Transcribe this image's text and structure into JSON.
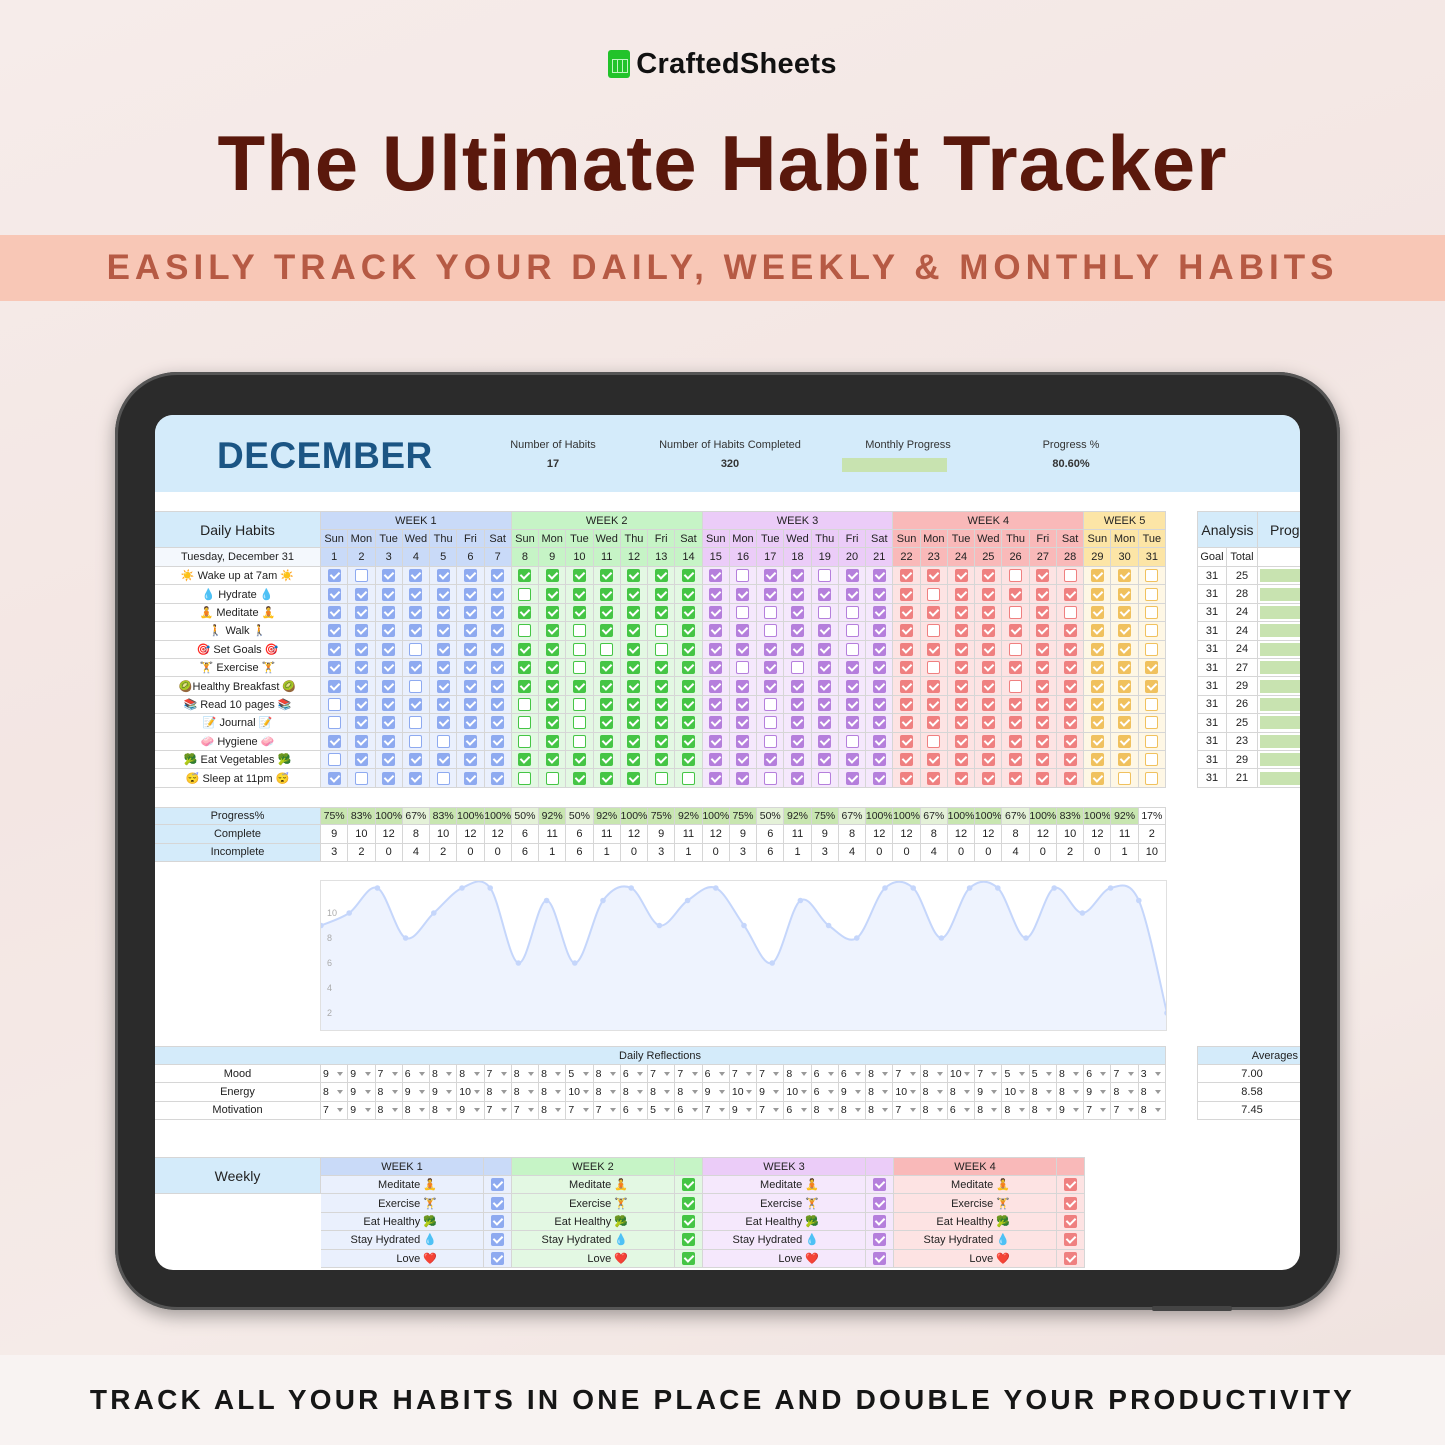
{
  "brand": {
    "name": "CraftedSheets",
    "logo_icon": "spreadsheet-logo-icon",
    "logo_color": "#22c32a"
  },
  "title": "The Ultimate Habit Tracker",
  "banner": "EASILY TRACK YOUR DAILY, WEEKLY & MONTHLY HABITS",
  "footer": "TRACK ALL YOUR HABITS IN ONE PLACE AND DOUBLE YOUR PRODUCTIVITY",
  "sheet": {
    "month": "DECEMBER",
    "stats": [
      {
        "label": "Number of Habits",
        "value": "17"
      },
      {
        "label": "Number of Habits Completed",
        "value": "320"
      },
      {
        "label": "Monthly Progress",
        "value": null,
        "progress_fraction": 0.806
      },
      {
        "label": "Progress %",
        "value": "80.60%"
      }
    ]
  },
  "colors": {
    "header_bg": "#d4ebfa",
    "progress_green": "#c8e3b0"
  },
  "daily": {
    "label": "Daily Habits",
    "current_date": "Tuesday, December 31",
    "weeks": [
      {
        "label": "WEEK 1",
        "days": 7,
        "header": "#c9daf8",
        "cell": "#eaf0fd",
        "check": "#8eaaf0"
      },
      {
        "label": "WEEK 2",
        "days": 7,
        "header": "#c6f4c6",
        "cell": "#e3f8e3",
        "check": "#45c545"
      },
      {
        "label": "WEEK 3",
        "days": 7,
        "header": "#ebccf8",
        "cell": "#f5e8fc",
        "check": "#b57fdc"
      },
      {
        "label": "WEEK 4",
        "days": 7,
        "header": "#f9b9b9",
        "cell": "#fde3e3",
        "check": "#ef8080"
      },
      {
        "label": "WEEK 5",
        "days": 3,
        "header": "#fce5a6",
        "cell": "#fef7e5",
        "check": "#f0c15e"
      }
    ],
    "day_names": [
      "Sun",
      "Mon",
      "Tue",
      "Wed",
      "Thu",
      "Fri",
      "Sat",
      "Sun",
      "Mon",
      "Tue",
      "Wed",
      "Thu",
      "Fri",
      "Sat",
      "Sun",
      "Mon",
      "Tue",
      "Wed",
      "Thu",
      "Fri",
      "Sat",
      "Sun",
      "Mon",
      "Tue",
      "Wed",
      "Thu",
      "Fri",
      "Sat",
      "Sun",
      "Mon",
      "Tue"
    ],
    "dates": [
      "1",
      "2",
      "3",
      "4",
      "5",
      "6",
      "7",
      "8",
      "9",
      "10",
      "11",
      "12",
      "13",
      "14",
      "15",
      "16",
      "17",
      "18",
      "19",
      "20",
      "21",
      "22",
      "23",
      "24",
      "25",
      "26",
      "27",
      "28",
      "29",
      "30",
      "31"
    ],
    "habits": [
      {
        "name": "☀️ Wake up at 7am ☀️",
        "goal": "31",
        "total": "25",
        "checks": [
          1,
          0,
          1,
          1,
          1,
          1,
          1,
          1,
          1,
          1,
          1,
          1,
          1,
          1,
          1,
          0,
          1,
          1,
          0,
          1,
          1,
          1,
          1,
          1,
          1,
          0,
          1,
          0,
          1,
          1,
          0
        ]
      },
      {
        "name": "💧 Hydrate 💧",
        "goal": "31",
        "total": "28",
        "checks": [
          1,
          1,
          1,
          1,
          1,
          1,
          1,
          0,
          1,
          1,
          1,
          1,
          1,
          1,
          1,
          1,
          1,
          1,
          1,
          1,
          1,
          1,
          0,
          1,
          1,
          1,
          1,
          1,
          1,
          1,
          0
        ]
      },
      {
        "name": "🧘 Meditate 🧘",
        "goal": "31",
        "total": "24",
        "checks": [
          1,
          1,
          1,
          1,
          1,
          1,
          1,
          1,
          1,
          1,
          1,
          1,
          1,
          1,
          1,
          0,
          0,
          1,
          0,
          0,
          1,
          1,
          1,
          1,
          1,
          0,
          1,
          0,
          1,
          1,
          0
        ]
      },
      {
        "name": "🚶 Walk 🚶",
        "goal": "31",
        "total": "24",
        "checks": [
          1,
          1,
          1,
          1,
          1,
          1,
          1,
          0,
          1,
          0,
          1,
          1,
          0,
          1,
          1,
          1,
          0,
          1,
          1,
          0,
          1,
          1,
          0,
          1,
          1,
          1,
          1,
          1,
          1,
          1,
          0
        ]
      },
      {
        "name": "🎯 Set Goals 🎯",
        "goal": "31",
        "total": "24",
        "checks": [
          1,
          1,
          1,
          0,
          1,
          1,
          1,
          1,
          1,
          0,
          0,
          1,
          0,
          1,
          1,
          1,
          1,
          1,
          1,
          0,
          1,
          1,
          1,
          1,
          1,
          0,
          1,
          1,
          1,
          1,
          0
        ]
      },
      {
        "name": "🏋️ Exercise 🏋️",
        "goal": "31",
        "total": "27",
        "checks": [
          1,
          1,
          1,
          1,
          1,
          1,
          1,
          1,
          1,
          0,
          1,
          1,
          1,
          1,
          1,
          0,
          1,
          0,
          1,
          1,
          1,
          1,
          0,
          1,
          1,
          1,
          1,
          1,
          1,
          1,
          1
        ]
      },
      {
        "name": "🥝Healthy Breakfast 🥝",
        "goal": "31",
        "total": "29",
        "checks": [
          1,
          1,
          1,
          0,
          1,
          1,
          1,
          1,
          1,
          1,
          1,
          1,
          1,
          1,
          1,
          1,
          1,
          1,
          1,
          1,
          1,
          1,
          1,
          1,
          1,
          0,
          1,
          1,
          1,
          1,
          1
        ]
      },
      {
        "name": "📚 Read 10 pages 📚",
        "goal": "31",
        "total": "26",
        "checks": [
          0,
          1,
          1,
          1,
          1,
          1,
          1,
          0,
          1,
          0,
          1,
          1,
          1,
          1,
          1,
          1,
          0,
          1,
          1,
          1,
          1,
          1,
          1,
          1,
          1,
          1,
          1,
          1,
          1,
          1,
          0
        ]
      },
      {
        "name": "📝 Journal 📝",
        "goal": "31",
        "total": "25",
        "checks": [
          0,
          1,
          1,
          0,
          1,
          1,
          1,
          0,
          1,
          0,
          1,
          1,
          1,
          1,
          1,
          1,
          0,
          1,
          1,
          1,
          1,
          1,
          1,
          1,
          1,
          1,
          1,
          1,
          1,
          1,
          0
        ]
      },
      {
        "name": "🧼 Hygiene 🧼",
        "goal": "31",
        "total": "23",
        "checks": [
          1,
          1,
          1,
          0,
          0,
          1,
          1,
          0,
          1,
          0,
          1,
          1,
          1,
          1,
          1,
          1,
          0,
          1,
          1,
          0,
          1,
          1,
          0,
          1,
          1,
          1,
          1,
          1,
          1,
          1,
          0
        ]
      },
      {
        "name": "🥦 Eat Vegetables 🥦",
        "goal": "31",
        "total": "29",
        "checks": [
          0,
          1,
          1,
          1,
          1,
          1,
          1,
          1,
          1,
          1,
          1,
          1,
          1,
          1,
          1,
          1,
          1,
          1,
          1,
          1,
          1,
          1,
          1,
          1,
          1,
          1,
          1,
          1,
          1,
          1,
          0
        ]
      },
      {
        "name": "😴 Sleep at 11pm 😴",
        "goal": "31",
        "total": "21",
        "checks": [
          1,
          0,
          1,
          1,
          0,
          1,
          1,
          0,
          0,
          1,
          1,
          1,
          0,
          0,
          1,
          1,
          0,
          1,
          0,
          1,
          1,
          1,
          1,
          1,
          1,
          1,
          1,
          1,
          1,
          0,
          0
        ]
      }
    ]
  },
  "analysis": {
    "label": "Analysis",
    "progress_label": "Prog",
    "goal_label": "Goal",
    "total_label": "Total"
  },
  "summary": [
    {
      "label": "Progress%",
      "values": [
        "75%",
        "83%",
        "100%",
        "67%",
        "83%",
        "100%",
        "100%",
        "50%",
        "92%",
        "50%",
        "92%",
        "100%",
        "75%",
        "92%",
        "100%",
        "75%",
        "50%",
        "92%",
        "75%",
        "67%",
        "100%",
        "100%",
        "67%",
        "100%",
        "100%",
        "67%",
        "100%",
        "83%",
        "100%",
        "92%",
        "17%"
      ]
    },
    {
      "label": "Complete",
      "values": [
        "9",
        "10",
        "12",
        "8",
        "10",
        "12",
        "12",
        "6",
        "11",
        "6",
        "11",
        "12",
        "9",
        "11",
        "12",
        "9",
        "6",
        "11",
        "9",
        "8",
        "12",
        "12",
        "8",
        "12",
        "12",
        "8",
        "12",
        "10",
        "12",
        "11",
        "2"
      ]
    },
    {
      "label": "Incomplete",
      "values": [
        "3",
        "2",
        "0",
        "4",
        "2",
        "0",
        "0",
        "6",
        "1",
        "6",
        "1",
        "0",
        "3",
        "1",
        "0",
        "3",
        "6",
        "1",
        "3",
        "4",
        "0",
        "0",
        "4",
        "0",
        "0",
        "4",
        "0",
        "2",
        "0",
        "1",
        "10"
      ]
    }
  ],
  "chart_data": {
    "type": "area",
    "x": [
      1,
      2,
      3,
      4,
      5,
      6,
      7,
      8,
      9,
      10,
      11,
      12,
      13,
      14,
      15,
      16,
      17,
      18,
      19,
      20,
      21,
      22,
      23,
      24,
      25,
      26,
      27,
      28,
      29,
      30,
      31
    ],
    "values": [
      9,
      10,
      12,
      8,
      10,
      12,
      12,
      6,
      11,
      6,
      11,
      12,
      9,
      11,
      12,
      9,
      6,
      11,
      9,
      8,
      12,
      12,
      8,
      12,
      12,
      8,
      12,
      10,
      12,
      11,
      2
    ],
    "yticks": [
      "2",
      "4",
      "6",
      "8",
      "10"
    ],
    "ylim": [
      0,
      12
    ],
    "grid": false,
    "line_color": "#c5d6fb",
    "fill_color": "#eef3fe"
  },
  "reflections": {
    "title": "Daily Reflections",
    "rows": [
      {
        "label": "Mood",
        "values": [
          "9",
          "9",
          "7",
          "6",
          "8",
          "8",
          "7",
          "8",
          "8",
          "5",
          "8",
          "6",
          "7",
          "7",
          "6",
          "7",
          "7",
          "8",
          "6",
          "6",
          "8",
          "7",
          "8",
          "10",
          "7",
          "5",
          "5",
          "8",
          "6",
          "7",
          "3"
        ]
      },
      {
        "label": "Energy",
        "values": [
          "8",
          "9",
          "8",
          "9",
          "9",
          "10",
          "8",
          "8",
          "8",
          "10",
          "8",
          "8",
          "8",
          "8",
          "9",
          "10",
          "9",
          "10",
          "6",
          "9",
          "8",
          "10",
          "8",
          "8",
          "9",
          "10",
          "8",
          "8",
          "9",
          "8",
          "8"
        ]
      },
      {
        "label": "Motivation",
        "values": [
          "7",
          "9",
          "8",
          "8",
          "8",
          "9",
          "7",
          "7",
          "8",
          "7",
          "7",
          "6",
          "5",
          "6",
          "7",
          "9",
          "7",
          "6",
          "8",
          "8",
          "8",
          "7",
          "8",
          "6",
          "8",
          "8",
          "8",
          "9",
          "7",
          "7",
          "8"
        ]
      }
    ],
    "averages_label": "Averages",
    "averages": [
      "7.00",
      "8.58",
      "7.45"
    ]
  },
  "weekly": {
    "label": "Weekly",
    "weeks": [
      {
        "label": "WEEK 1",
        "items": [
          {
            "name": "Meditate 🧘",
            "checked": true
          },
          {
            "name": "Exercise 🏋️",
            "checked": true
          },
          {
            "name": "Eat Healthy 🥦",
            "checked": true
          },
          {
            "name": "Stay Hydrated 💧",
            "checked": true
          },
          {
            "name": "Love ❤️",
            "checked": true
          }
        ]
      },
      {
        "label": "WEEK 2",
        "items": [
          {
            "name": "Meditate 🧘",
            "checked": true
          },
          {
            "name": "Exercise 🏋️",
            "checked": true
          },
          {
            "name": "Eat Healthy 🥦",
            "checked": true
          },
          {
            "name": "Stay Hydrated 💧",
            "checked": true
          },
          {
            "name": "Love ❤️",
            "checked": true
          }
        ]
      },
      {
        "label": "WEEK 3",
        "items": [
          {
            "name": "Meditate 🧘",
            "checked": true
          },
          {
            "name": "Exercise 🏋️",
            "checked": true
          },
          {
            "name": "Eat Healthy 🥦",
            "checked": true
          },
          {
            "name": "Stay Hydrated 💧",
            "checked": true
          },
          {
            "name": "Love ❤️",
            "checked": true
          }
        ]
      },
      {
        "label": "WEEK 4",
        "items": [
          {
            "name": "Meditate 🧘",
            "checked": true
          },
          {
            "name": "Exercise 🏋️",
            "checked": true
          },
          {
            "name": "Eat Healthy 🥦",
            "checked": true
          },
          {
            "name": "Stay Hydrated 💧",
            "checked": true
          },
          {
            "name": "Love ❤️",
            "checked": true
          }
        ]
      }
    ]
  }
}
